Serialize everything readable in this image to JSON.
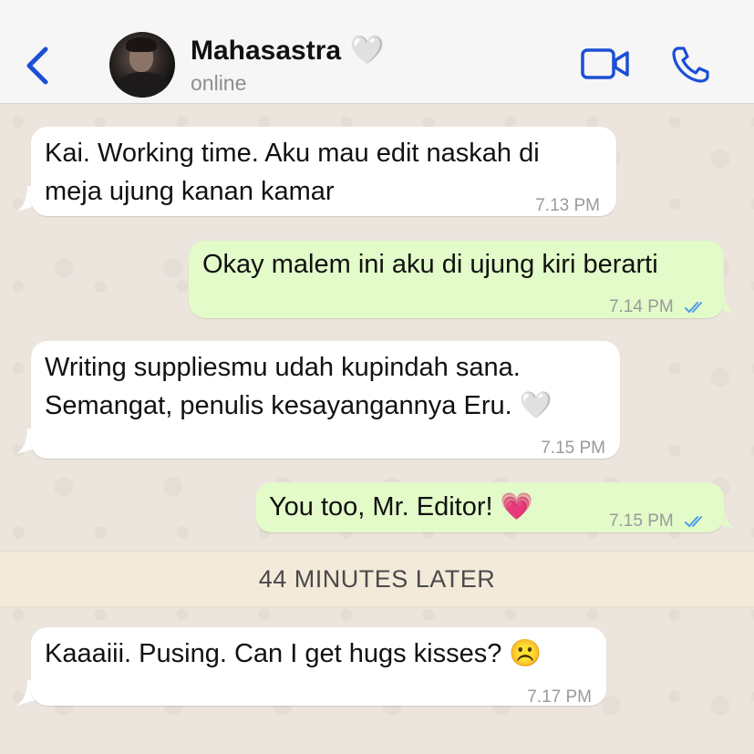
{
  "header": {
    "contact_name": "Mahasastra",
    "name_emoji": "🤍",
    "status": "online",
    "back_icon": "chevron-left-icon",
    "video_icon": "video-camera-icon",
    "call_icon": "phone-icon",
    "accent_color": "#1c4fd6"
  },
  "messages": [
    {
      "direction": "in",
      "lines": [
        "Kai. Working time. Aku mau edit naskah di",
        "meja ujung kanan kamar"
      ],
      "time": "7.13 PM"
    },
    {
      "direction": "out",
      "lines": [
        "Okay malem ini aku di ujung kiri berarti"
      ],
      "time": "7.14 PM",
      "read": true
    },
    {
      "direction": "in",
      "lines": [
        "Writing suppliesmu udah kupindah sana.",
        "Semangat, penulis kesayangannya Eru. 🤍"
      ],
      "time": "7.15 PM"
    },
    {
      "direction": "out",
      "lines": [
        "You too, Mr. Editor! 💗"
      ],
      "time": "7.15 PM",
      "read": true
    },
    {
      "direction": "in",
      "lines": [
        "Kaaaiii. Pusing. Can I get hugs kisses? ☹️"
      ],
      "time": "7.17 PM"
    }
  ],
  "divider": {
    "text": "44 MINUTES LATER"
  },
  "colors": {
    "incoming_bubble": "#ffffff",
    "outgoing_bubble": "#e2fbc9",
    "read_ticks": "#4f9fe6",
    "chat_background": "#ece5dd"
  }
}
